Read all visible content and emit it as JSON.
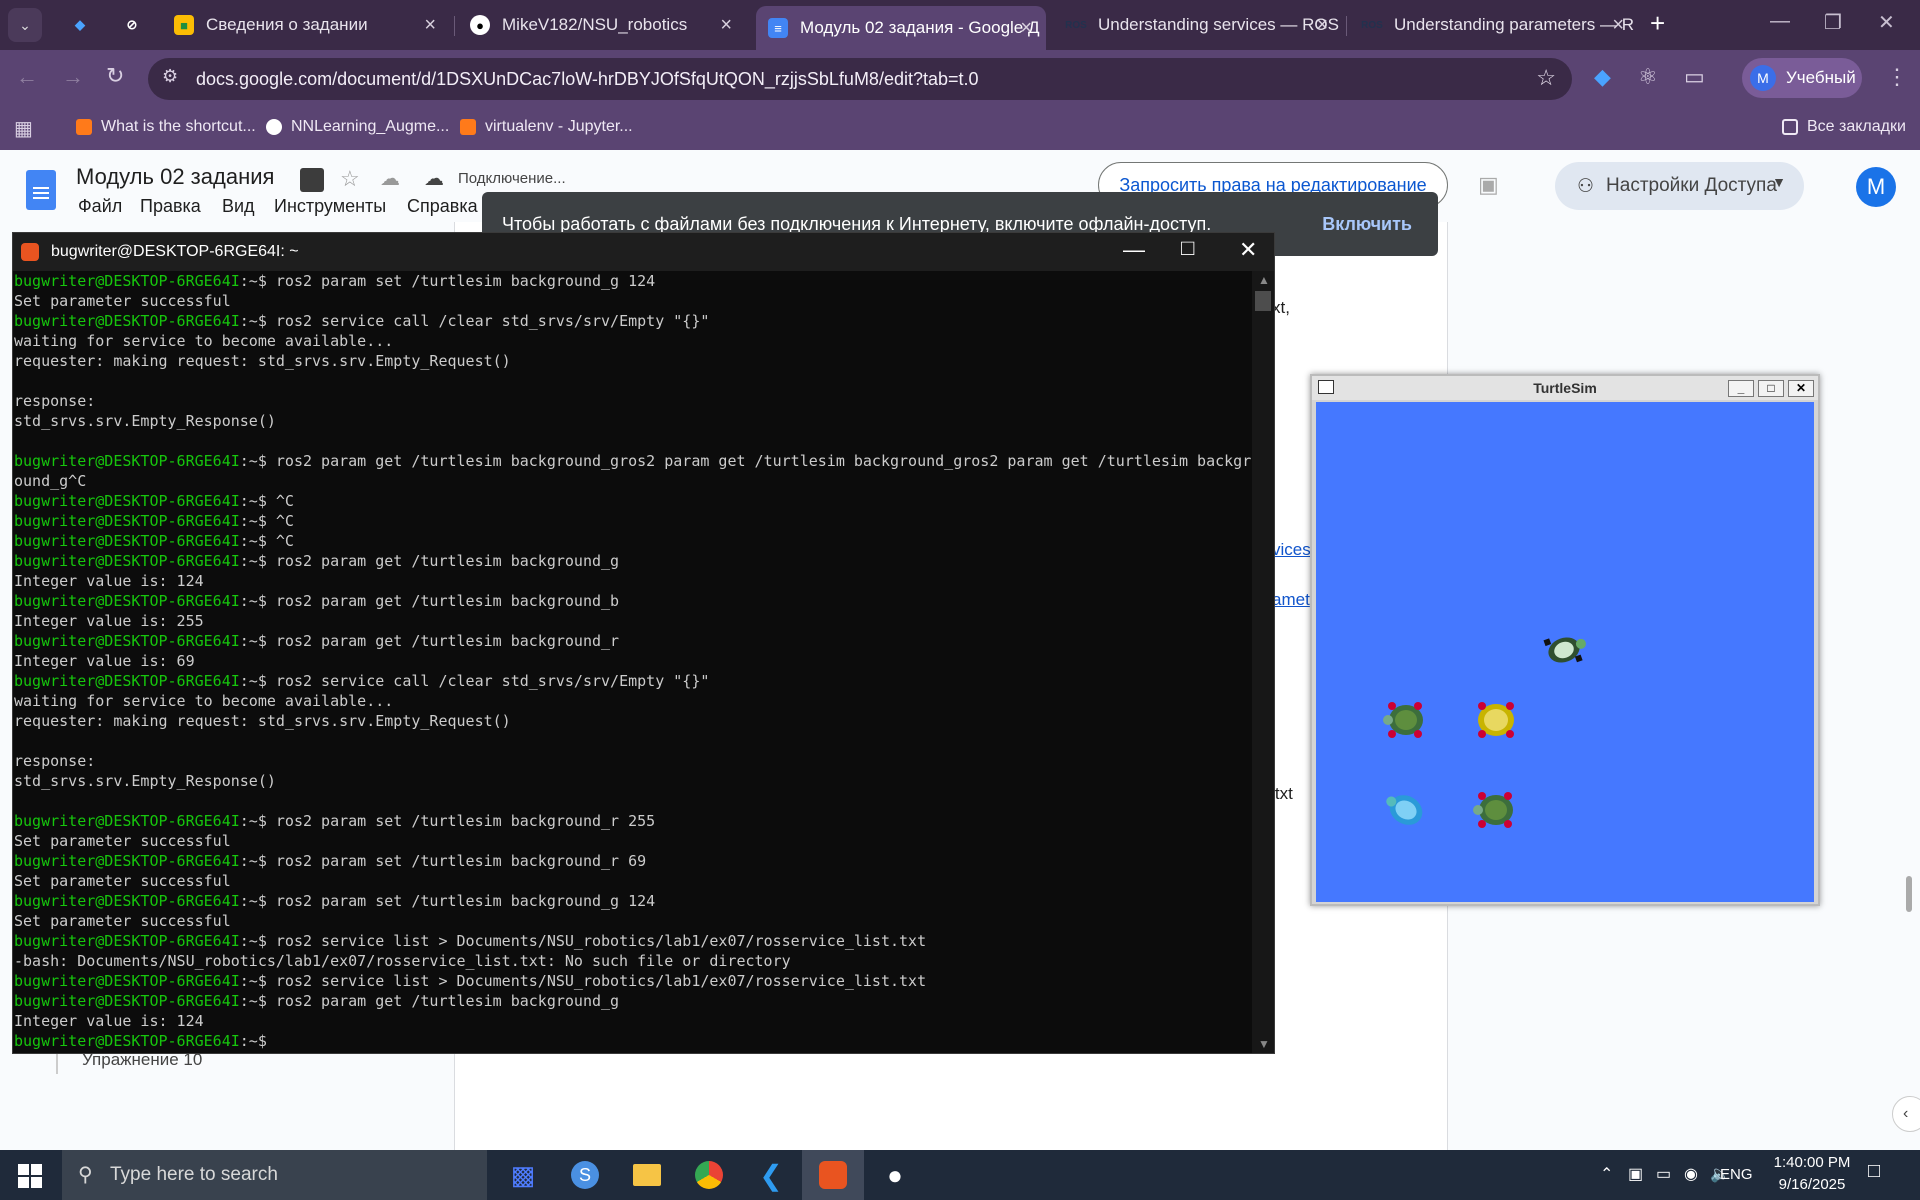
{
  "browser": {
    "tabs": [
      {
        "label": "",
        "favicon": "gem-icon"
      },
      {
        "label": "",
        "favicon": "slashed-circle-icon"
      },
      {
        "label": "Сведения о задании",
        "favicon": "classroom-icon"
      },
      {
        "label": "MikeV182/NSU_robotics",
        "favicon": "github-icon"
      },
      {
        "label": "Модуль 02 задания - Google Д",
        "favicon": "docs-icon"
      },
      {
        "label": "Understanding services — ROS",
        "favicon": "ros-icon"
      },
      {
        "label": "Understanding parameters — R",
        "favicon": "ros-icon"
      }
    ],
    "url": "docs.google.com/document/d/1DSXUnDCac7loW-hrDBYJOfSfqUtQON_rzjjsSbLfuM8/edit?tab=t.0",
    "profile_label": "Учебный",
    "profile_initial": "M",
    "bookmarks": [
      "What is the shortcut...",
      "NNLearning_Augme...",
      "virtualenv - Jupyter..."
    ],
    "all_bookmarks": "Все закладки"
  },
  "docs": {
    "title": "Модуль 02 задания",
    "status": "Подключение...",
    "menu": [
      "Файл",
      "Правка",
      "Вид",
      "Инструменты",
      "Справка"
    ],
    "request_edit": "Запросить права на редактирование",
    "share": "Настройки Доступа",
    "avatar": "M",
    "offline_msg": "Чтобы работать с файлами без подключения к Интернету, включите офлайн-доступ.",
    "offline_action": "Включить",
    "outline_item": "Упражнение 10",
    "fragments": [
      "xt,",
      "vices",
      "amet",
      "er.txt"
    ]
  },
  "terminal": {
    "title": "bugwriter@DESKTOP-6RGE64I: ~",
    "lines": [
      {
        "p": "bugwriter@DESKTOP-6RGE64I",
        "c": "ros2 param set /turtlesim background_g 124"
      },
      {
        "t": "Set parameter successful"
      },
      {
        "p": "bugwriter@DESKTOP-6RGE64I",
        "c": "ros2 service call /clear std_srvs/srv/Empty \"{}\""
      },
      {
        "t": "waiting for service to become available..."
      },
      {
        "t": "requester: making request: std_srvs.srv.Empty_Request()"
      },
      {
        "t": ""
      },
      {
        "t": "response:"
      },
      {
        "t": "std_srvs.srv.Empty_Response()"
      },
      {
        "t": ""
      },
      {
        "p": "bugwriter@DESKTOP-6RGE64I",
        "c": "ros2 param get /turtlesim background_gros2 param get /turtlesim background_gros2 param get /turtlesim backgr"
      },
      {
        "t": "ound_g^C"
      },
      {
        "p": "bugwriter@DESKTOP-6RGE64I",
        "c": "^C"
      },
      {
        "p": "bugwriter@DESKTOP-6RGE64I",
        "c": "^C"
      },
      {
        "p": "bugwriter@DESKTOP-6RGE64I",
        "c": "^C"
      },
      {
        "p": "bugwriter@DESKTOP-6RGE64I",
        "c": "ros2 param get /turtlesim background_g"
      },
      {
        "t": "Integer value is: 124"
      },
      {
        "p": "bugwriter@DESKTOP-6RGE64I",
        "c": "ros2 param get /turtlesim background_b"
      },
      {
        "t": "Integer value is: 255"
      },
      {
        "p": "bugwriter@DESKTOP-6RGE64I",
        "c": "ros2 param get /turtlesim background_r"
      },
      {
        "t": "Integer value is: 69"
      },
      {
        "p": "bugwriter@DESKTOP-6RGE64I",
        "c": "ros2 service call /clear std_srvs/srv/Empty \"{}\""
      },
      {
        "t": "waiting for service to become available..."
      },
      {
        "t": "requester: making request: std_srvs.srv.Empty_Request()"
      },
      {
        "t": ""
      },
      {
        "t": "response:"
      },
      {
        "t": "std_srvs.srv.Empty_Response()"
      },
      {
        "t": ""
      },
      {
        "p": "bugwriter@DESKTOP-6RGE64I",
        "c": "ros2 param set /turtlesim background_r 255"
      },
      {
        "t": "Set parameter successful"
      },
      {
        "p": "bugwriter@DESKTOP-6RGE64I",
        "c": "ros2 param set /turtlesim background_r 69"
      },
      {
        "t": "Set parameter successful"
      },
      {
        "p": "bugwriter@DESKTOP-6RGE64I",
        "c": "ros2 param set /turtlesim background_g 124"
      },
      {
        "t": "Set parameter successful"
      },
      {
        "p": "bugwriter@DESKTOP-6RGE64I",
        "c": "ros2 service list > Documents/NSU_robotics/lab1/ex07/rosservice_list.txt"
      },
      {
        "t": "-bash: Documents/NSU_robotics/lab1/ex07/rosservice_list.txt: No such file or directory"
      },
      {
        "p": "bugwriter@DESKTOP-6RGE64I",
        "c": "ros2 service list > Documents/NSU_robotics/lab1/ex07/rosservice_list.txt"
      },
      {
        "p": "bugwriter@DESKTOP-6RGE64I",
        "c": "ros2 param get /turtlesim background_g"
      },
      {
        "t": "Integer value is: 124"
      },
      {
        "p": "bugwriter@DESKTOP-6RGE64I",
        "c": ""
      }
    ]
  },
  "turtlesim": {
    "title": "TurtleSim",
    "background": "#4578ff",
    "turtles": [
      "turtle-icon",
      "turtle-icon",
      "turtle-icon",
      "turtle-icon",
      "turtle-icon"
    ]
  },
  "taskbar": {
    "search_placeholder": "Type here to search",
    "apps": [
      "chart-icon",
      "slashed-circle-icon",
      "folder-icon",
      "chrome-icon",
      "vscode-icon",
      "ubuntu-icon",
      "linux-icon"
    ],
    "lang": "ENG",
    "time": "1:40:00 PM",
    "date": "9/16/2025"
  }
}
